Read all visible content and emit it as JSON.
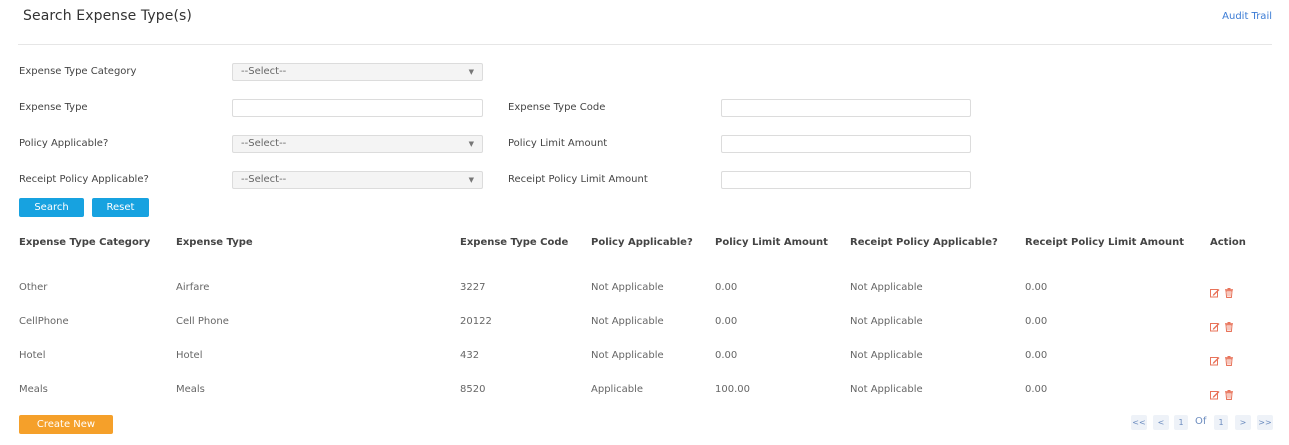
{
  "header": {
    "title": "Search Expense Type(s)",
    "audit_trail": "Audit Trail"
  },
  "form": {
    "expense_type_category_label": "Expense Type Category",
    "expense_type_category_value": "--Select--",
    "expense_type_label": "Expense Type",
    "expense_type_value": "",
    "expense_type_code_label": "Expense Type Code",
    "expense_type_code_value": "",
    "policy_applicable_label": "Policy Applicable?",
    "policy_applicable_value": "--Select--",
    "policy_limit_amount_label": "Policy Limit Amount",
    "policy_limit_amount_value": "",
    "receipt_policy_applicable_label": "Receipt Policy Applicable?",
    "receipt_policy_applicable_value": "--Select--",
    "receipt_policy_limit_amount_label": "Receipt Policy Limit Amount",
    "receipt_policy_limit_amount_value": "",
    "search_label": "Search",
    "reset_label": "Reset"
  },
  "table": {
    "headers": [
      "Expense Type Category",
      "Expense Type",
      "Expense Type Code",
      "Policy Applicable?",
      "Policy Limit Amount",
      "Receipt Policy Applicable?",
      "Receipt Policy Limit Amount",
      "Action"
    ],
    "rows": [
      [
        "Other",
        "Airfare",
        "3227",
        "Not Applicable",
        "0.00",
        "Not Applicable",
        "0.00"
      ],
      [
        "CellPhone",
        "Cell Phone",
        "20122",
        "Not Applicable",
        "0.00",
        "Not Applicable",
        "0.00"
      ],
      [
        "Hotel",
        "Hotel",
        "432",
        "Not Applicable",
        "0.00",
        "Not Applicable",
        "0.00"
      ],
      [
        "Meals",
        "Meals",
        "8520",
        "Applicable",
        "100.00",
        "Not Applicable",
        "0.00"
      ]
    ],
    "action_icons": [
      "edit-icon",
      "delete-icon"
    ],
    "action_color": "#e8735a"
  },
  "footer": {
    "create_new_label": "Create New",
    "pagination": {
      "first": "<<",
      "prev": "<",
      "current_page": "1",
      "of_label": "Of",
      "total_pages": "1",
      "next": ">",
      "last": ">>"
    }
  }
}
